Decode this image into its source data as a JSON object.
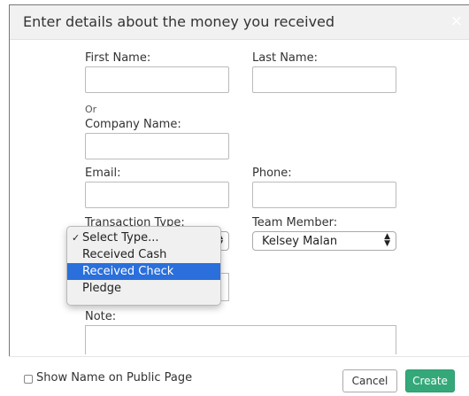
{
  "dialog": {
    "title": "Enter details about the money you received",
    "close_glyph": "×"
  },
  "form": {
    "first_name": {
      "label": "First Name:",
      "value": ""
    },
    "last_name": {
      "label": "Last Name:",
      "value": ""
    },
    "or_text": "Or",
    "company_name": {
      "label": "Company Name:",
      "value": ""
    },
    "email": {
      "label": "Email:",
      "value": ""
    },
    "phone": {
      "label": "Phone:",
      "value": ""
    },
    "transaction_type": {
      "label": "Transaction Type:",
      "options": [
        "Select Type...",
        "Received Cash",
        "Received Check",
        "Pledge"
      ],
      "checked": "Select Type...",
      "highlighted": "Received Check"
    },
    "team_member": {
      "label": "Team Member:",
      "value": "Kelsey Malan"
    },
    "note": {
      "label": "Note:",
      "value": ""
    }
  },
  "footer": {
    "show_name_label": "Show Name on Public Page",
    "show_name_checked": false,
    "cancel_label": "Cancel",
    "create_label": "Create"
  },
  "colors": {
    "create_button": "#35a87a",
    "highlight": "#2a6fdb",
    "header_bg": "#f1f1f1"
  }
}
